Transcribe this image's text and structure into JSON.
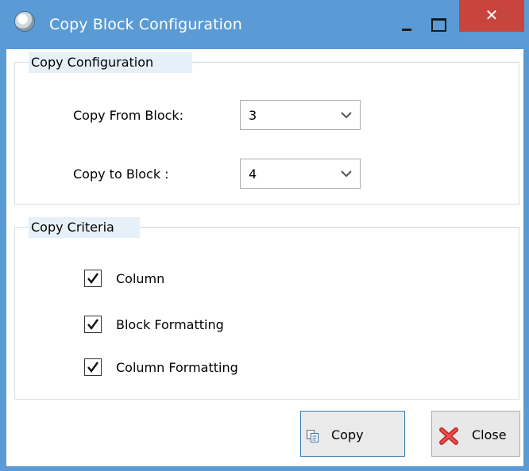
{
  "window": {
    "title": "Copy Block Configuration",
    "close_glyph": "✕",
    "icons": {
      "app": "app-logo-icon",
      "minimize": "minimize-icon",
      "maximize": "maximize-icon",
      "close": "close-icon"
    }
  },
  "copy_configuration": {
    "legend": "Copy Configuration",
    "from_label": "Copy From Block:",
    "from_value": "3",
    "to_label": "Copy to Block :",
    "to_value": "4"
  },
  "copy_criteria": {
    "legend": "Copy Criteria",
    "items": [
      {
        "label": "Column",
        "checked": true
      },
      {
        "label": "Block Formatting",
        "checked": true
      },
      {
        "label": "Column Formatting",
        "checked": true
      }
    ]
  },
  "buttons": {
    "copy_label": "Copy",
    "close_label": "Close",
    "copy_icon": "copy-icon",
    "close_icon": "red-x-icon"
  },
  "colors": {
    "titlebar": "#5b9bd5",
    "close_button": "#c7453c",
    "legend_background": "#e6f0f8"
  }
}
